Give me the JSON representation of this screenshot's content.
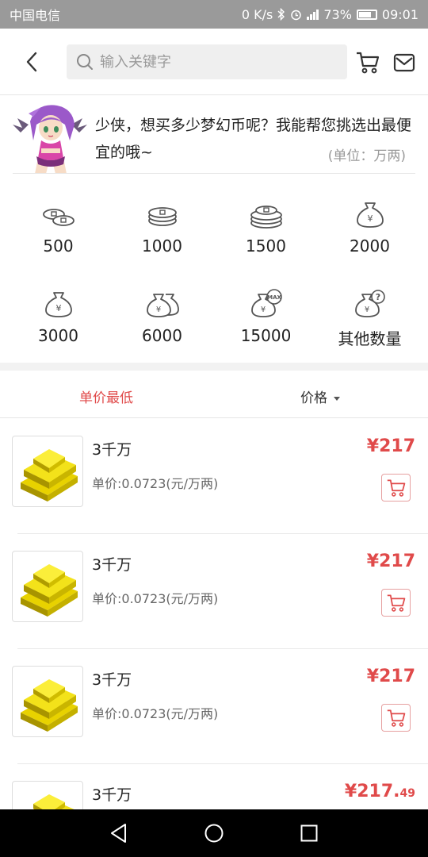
{
  "status_bar": {
    "carrier": "中国电信",
    "speed": "0 K/s",
    "battery": "73%",
    "time": "09:01"
  },
  "header": {
    "search_placeholder": "输入关键字"
  },
  "intro": {
    "message": "少侠，想买多少梦幻币呢？我能帮您挑选出最便宜的哦~",
    "unit": "(单位：万两)"
  },
  "amounts": [
    {
      "label": "500",
      "icon": "coins-small-icon"
    },
    {
      "label": "1000",
      "icon": "coins-stack-icon"
    },
    {
      "label": "1500",
      "icon": "coins-large-stack-icon"
    },
    {
      "label": "2000",
      "icon": "money-bag-icon"
    },
    {
      "label": "3000",
      "icon": "money-bag-icon"
    },
    {
      "label": "6000",
      "icon": "money-bags-icon"
    },
    {
      "label": "15000",
      "icon": "money-bag-max-icon"
    },
    {
      "label": "其他数量",
      "icon": "money-bag-question-icon"
    }
  ],
  "sort": {
    "lowest_unit_price": "单价最低",
    "price": "价格"
  },
  "products": [
    {
      "name": "3千万",
      "unit_price": "单价:0.0723(元/万两)",
      "price": "¥217",
      "price_decimal": ""
    },
    {
      "name": "3千万",
      "unit_price": "单价:0.0723(元/万两)",
      "price": "¥217",
      "price_decimal": ""
    },
    {
      "name": "3千万",
      "unit_price": "单价:0.0723(元/万两)",
      "price": "¥217",
      "price_decimal": ""
    },
    {
      "name": "3千万",
      "unit_price": "",
      "price": "¥217.",
      "price_decimal": "49"
    }
  ],
  "colors": {
    "accent": "#e04a4a",
    "status_bar": "#9a9a9a",
    "nav_bar": "#000000"
  }
}
